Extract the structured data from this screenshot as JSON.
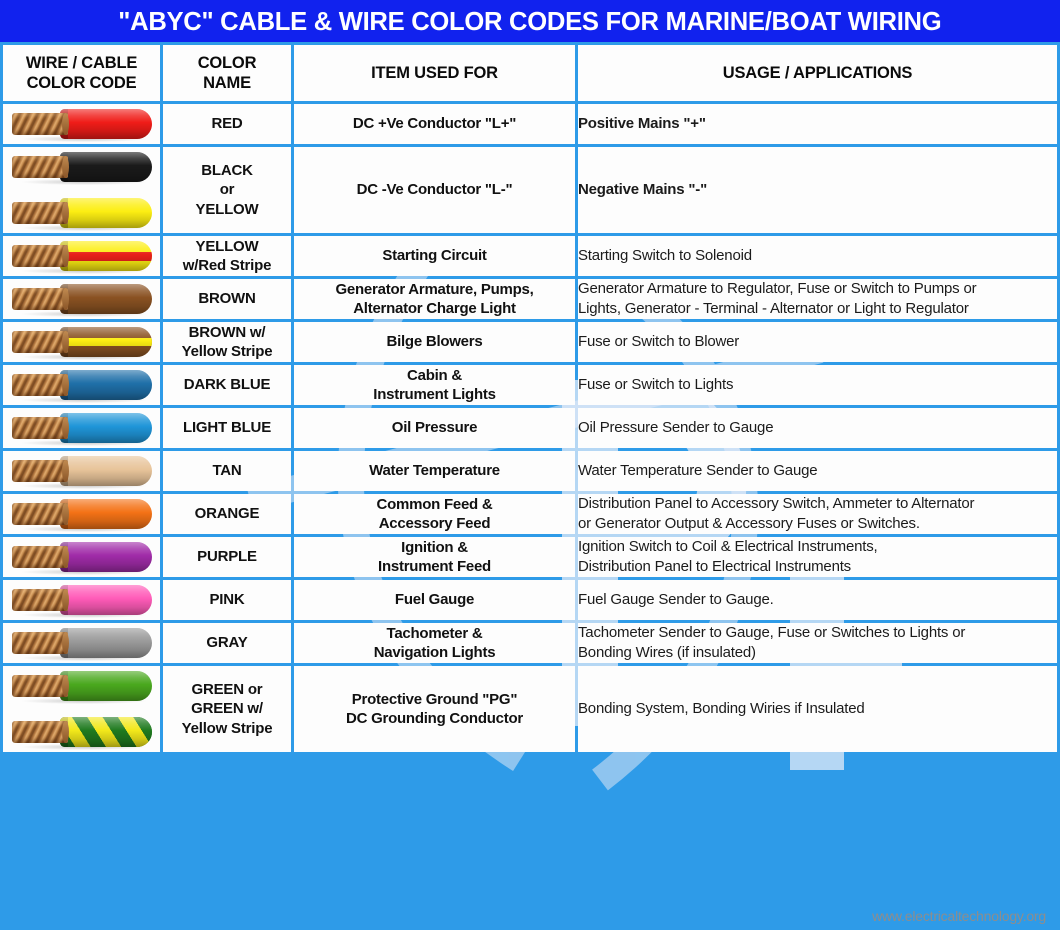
{
  "title": "\"ABYC\" CABLE & WIRE COLOR CODES FOR MARINE/BOAT WIRING",
  "credit": "www.electricaltechnology.org",
  "colors": {
    "title_bar": "#1122EE",
    "grid_line": "#2E9BE8",
    "cell_bg": "#FDFDFD",
    "text": "#111111",
    "credit_text": "#8D8D8D"
  },
  "headers": {
    "wire": "WIRE / CABLE\nCOLOR CODE",
    "wire_line1": "WIRE / CABLE",
    "wire_line2": "COLOR CODE",
    "name_line1": "COLOR",
    "name_line2": "NAME",
    "item": "ITEM USED FOR",
    "usage": "USAGE / APPLICATIONS"
  },
  "rows": [
    {
      "name": "RED",
      "name_lines": [
        "RED"
      ],
      "item": "DC +Ve Conductor \"L+\"",
      "item_lines": [
        "DC +Ve Conductor \"L+\""
      ],
      "usage": "Positive Mains \"+\"",
      "usage_lines": [
        "Positive Mains \"+\""
      ],
      "usage_bold": true,
      "wires": [
        {
          "type": "solid",
          "color": "#F01C18"
        }
      ]
    },
    {
      "name": "BLACK or YELLOW",
      "name_lines": [
        "BLACK",
        "or",
        "YELLOW"
      ],
      "item": "DC -Ve Conductor \"L-\"",
      "item_lines": [
        "DC -Ve Conductor \"L-\""
      ],
      "usage": "Negative Mains \"-\"",
      "usage_lines": [
        "Negative Mains \"-\""
      ],
      "usage_bold": true,
      "wires": [
        {
          "type": "solid",
          "color": "#1A1A1A"
        },
        {
          "type": "solid",
          "color": "#FCEE12"
        }
      ]
    },
    {
      "name": "YELLOW w/Red Stripe",
      "name_lines": [
        "YELLOW",
        "w/Red Stripe"
      ],
      "item": "Starting Circuit",
      "item_lines": [
        "Starting Circuit"
      ],
      "usage": "Starting Switch to Solenoid",
      "usage_lines": [
        "Starting Switch to Solenoid"
      ],
      "usage_bold": false,
      "wires": [
        {
          "type": "band",
          "color": "#FCEE12",
          "stripe": "#E8201A"
        }
      ]
    },
    {
      "name": "BROWN",
      "name_lines": [
        "BROWN"
      ],
      "item": "Generator Armature, Pumps, Alternator Charge Light",
      "item_lines": [
        "Generator Armature, Pumps,",
        "Alternator Charge Light"
      ],
      "usage": "Generator Armature to Regulator, Fuse or Switch to Pumps or Lights, Generator - Terminal - Alternator or Light to Regulator",
      "usage_lines": [
        "Generator Armature to Regulator, Fuse or Switch to Pumps or",
        "Lights, Generator - Terminal - Alternator or Light to Regulator"
      ],
      "usage_bold": false,
      "wires": [
        {
          "type": "solid",
          "color": "#8A5222"
        }
      ]
    },
    {
      "name": "BROWN w/ Yellow Stripe",
      "name_lines": [
        "BROWN w/",
        "Yellow Stripe"
      ],
      "item": "Bilge Blowers",
      "item_lines": [
        "Bilge Blowers"
      ],
      "usage": "Fuse or Switch to Blower",
      "usage_lines": [
        "Fuse or Switch to Blower"
      ],
      "usage_bold": false,
      "wires": [
        {
          "type": "band-thin",
          "color": "#8A5222",
          "stripe": "#FCEE12"
        }
      ]
    },
    {
      "name": "DARK BLUE",
      "name_lines": [
        "DARK BLUE"
      ],
      "item": "Cabin & Instrument Lights",
      "item_lines": [
        "Cabin &",
        "Instrument Lights"
      ],
      "usage": "Fuse or Switch to Lights",
      "usage_lines": [
        "Fuse or Switch to Lights"
      ],
      "usage_bold": false,
      "wires": [
        {
          "type": "solid",
          "color": "#1F6FA8"
        }
      ]
    },
    {
      "name": "LIGHT BLUE",
      "name_lines": [
        "LIGHT BLUE"
      ],
      "item": "Oil Pressure",
      "item_lines": [
        "Oil Pressure"
      ],
      "usage": "Oil Pressure Sender to Gauge",
      "usage_lines": [
        "Oil Pressure Sender to Gauge"
      ],
      "usage_bold": false,
      "wires": [
        {
          "type": "solid",
          "color": "#1F95D8"
        }
      ]
    },
    {
      "name": "TAN",
      "name_lines": [
        "TAN"
      ],
      "item": "Water Temperature",
      "item_lines": [
        "Water Temperature"
      ],
      "usage": "Water Temperature Sender to Gauge",
      "usage_lines": [
        "Water Temperature Sender to Gauge"
      ],
      "usage_bold": false,
      "wires": [
        {
          "type": "solid",
          "color": "#E8C49A"
        }
      ]
    },
    {
      "name": "ORANGE",
      "name_lines": [
        "ORANGE"
      ],
      "item": "Common Feed & Accessory Feed",
      "item_lines": [
        "Common Feed &",
        "Accessory Feed"
      ],
      "usage": "Distribution Panel to Accessory Switch, Ammeter to Alternator or Generator Output & Accessory Fuses or Switches.",
      "usage_lines": [
        "Distribution Panel to Accessory Switch, Ammeter to Alternator",
        "or Generator Output & Accessory Fuses or Switches."
      ],
      "usage_bold": false,
      "wires": [
        {
          "type": "solid",
          "color": "#F47216"
        }
      ]
    },
    {
      "name": "PURPLE",
      "name_lines": [
        "PURPLE"
      ],
      "item": "Ignition & Instrument Feed",
      "item_lines": [
        "Ignition &",
        "Instrument Feed"
      ],
      "usage": "Ignition Switch to Coil & Electrical Instruments, Distribution Panel to Electrical Instruments",
      "usage_lines": [
        "Ignition Switch to Coil & Electrical Instruments,",
        "Distribution Panel to Electrical Instruments"
      ],
      "usage_bold": false,
      "wires": [
        {
          "type": "solid",
          "color": "#A02BA8"
        }
      ]
    },
    {
      "name": "PINK",
      "name_lines": [
        "PINK"
      ],
      "item": "Fuel Gauge",
      "item_lines": [
        "Fuel Gauge"
      ],
      "usage": "Fuel Gauge Sender to Gauge.",
      "usage_lines": [
        "Fuel Gauge Sender to Gauge."
      ],
      "usage_bold": false,
      "wires": [
        {
          "type": "solid",
          "color": "#FF5BB8"
        }
      ]
    },
    {
      "name": "GRAY",
      "name_lines": [
        "GRAY"
      ],
      "item": "Tachometer & Navigation Lights",
      "item_lines": [
        "Tachometer &",
        "Navigation Lights"
      ],
      "usage": "Tachometer Sender to Gauge, Fuse or Switches to Lights or Bonding Wires (if insulated)",
      "usage_lines": [
        "Tachometer Sender to Gauge, Fuse or Switches to Lights or",
        "Bonding Wires (if insulated)"
      ],
      "usage_bold": false,
      "wires": [
        {
          "type": "solid",
          "color": "#9A9A9A"
        }
      ]
    },
    {
      "name": "GREEN or GREEN w/ Yellow Stripe",
      "name_lines": [
        "GREEN or",
        "GREEN w/",
        "Yellow Stripe"
      ],
      "item": "Protective Ground \"PG\" DC Grounding Conductor",
      "item_lines": [
        "Protective Ground \"PG\"",
        "DC Grounding Conductor"
      ],
      "usage": "Bonding System, Bonding Wiries if Insulated",
      "usage_lines": [
        "Bonding System, Bonding Wiries if Insulated"
      ],
      "usage_bold": false,
      "wires": [
        {
          "type": "solid",
          "color": "#4AA81E"
        },
        {
          "type": "helix",
          "color": "#1F7A1F",
          "stripe": "#F2E81A"
        }
      ]
    }
  ]
}
